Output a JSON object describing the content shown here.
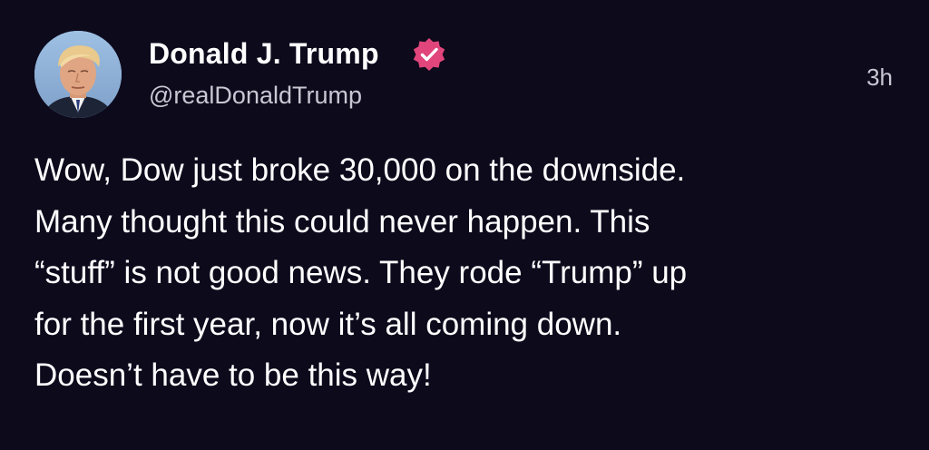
{
  "post": {
    "author": {
      "display_name": "Donald J. Trump",
      "handle": "@realDonaldTrump",
      "verified": true
    },
    "timestamp": "3h",
    "text_lines": [
      "Wow, Dow just broke 30,000 on the downside.",
      "Many thought this could never happen. This",
      "“stuff” is not good news. They rode “Trump” up",
      "for the first year, now it’s all coming down.",
      "Doesn’t have to be this way!"
    ]
  },
  "colors": {
    "background": "#0d0a1c",
    "text": "#ffffff",
    "secondary_text": "#c9c7d2",
    "verified_badge": "#e0457b"
  },
  "icons": {
    "avatar": "profile-photo",
    "verified": "verified-badge-icon"
  }
}
